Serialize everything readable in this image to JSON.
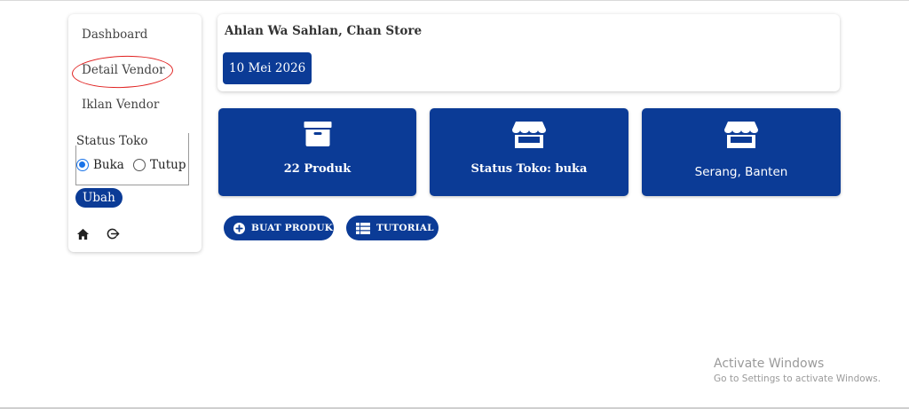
{
  "sidebar": {
    "items": [
      {
        "label": "Dashboard"
      },
      {
        "label": "Detail Vendor"
      },
      {
        "label": "Iklan Vendor"
      }
    ],
    "status": {
      "title": "Status Toko",
      "options": [
        {
          "label": "Buka",
          "checked": true
        },
        {
          "label": "Tutup",
          "checked": false
        }
      ],
      "submit_label": "Ubah"
    },
    "icons": [
      "home-icon",
      "logout-icon"
    ]
  },
  "header": {
    "greeting": "Ahlan Wa Sahlan, Chan Store",
    "date": "10 Mei 2026"
  },
  "stats": [
    {
      "icon": "archive-box-icon",
      "label": "22 Produk"
    },
    {
      "icon": "store-icon",
      "label": "Status Toko: buka"
    },
    {
      "icon": "store-icon",
      "label": "Serang, Banten"
    }
  ],
  "actions": {
    "create_product": {
      "icon": "plus-circle-icon",
      "label": "BUAT PRODUK"
    },
    "tutorial": {
      "icon": "table-list-icon",
      "label": "TUTORIAL"
    }
  },
  "watermark": {
    "title": "Activate Windows",
    "subtitle": "Go to Settings to activate Windows."
  },
  "colors": {
    "primary": "#0b3b96",
    "annotation": "#e0201f",
    "radio_checked": "#1a73e8"
  }
}
